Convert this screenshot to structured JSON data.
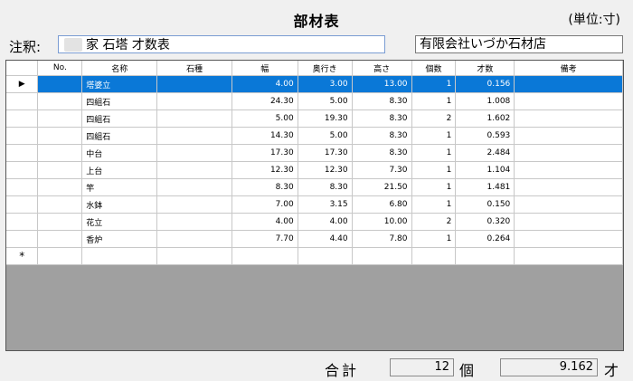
{
  "header": {
    "title": "部材表",
    "unit_label": "(単位:寸)"
  },
  "note": {
    "label": "注釈:",
    "value": "家 石塔 才数表",
    "company": "有限会社いづか石材店"
  },
  "grid": {
    "columns": [
      "No.",
      "名称",
      "石種",
      "幅",
      "奥行き",
      "高さ",
      "個数",
      "才数",
      "備考"
    ],
    "row_marker": "▶",
    "new_row_marker": "*",
    "rows": [
      {
        "no": "",
        "name": "塔婆立",
        "stone": "",
        "width": "4.00",
        "depth": "3.00",
        "height": "13.00",
        "count": "1",
        "sai": "0.156",
        "note": ""
      },
      {
        "no": "",
        "name": "四組石",
        "stone": "",
        "width": "24.30",
        "depth": "5.00",
        "height": "8.30",
        "count": "1",
        "sai": "1.008",
        "note": ""
      },
      {
        "no": "",
        "name": "四組石",
        "stone": "",
        "width": "5.00",
        "depth": "19.30",
        "height": "8.30",
        "count": "2",
        "sai": "1.602",
        "note": ""
      },
      {
        "no": "",
        "name": "四組石",
        "stone": "",
        "width": "14.30",
        "depth": "5.00",
        "height": "8.30",
        "count": "1",
        "sai": "0.593",
        "note": ""
      },
      {
        "no": "",
        "name": "中台",
        "stone": "",
        "width": "17.30",
        "depth": "17.30",
        "height": "8.30",
        "count": "1",
        "sai": "2.484",
        "note": ""
      },
      {
        "no": "",
        "name": "上台",
        "stone": "",
        "width": "12.30",
        "depth": "12.30",
        "height": "7.30",
        "count": "1",
        "sai": "1.104",
        "note": ""
      },
      {
        "no": "",
        "name": "竿",
        "stone": "",
        "width": "8.30",
        "depth": "8.30",
        "height": "21.50",
        "count": "1",
        "sai": "1.481",
        "note": ""
      },
      {
        "no": "",
        "name": "水鉢",
        "stone": "",
        "width": "7.00",
        "depth": "3.15",
        "height": "6.80",
        "count": "1",
        "sai": "0.150",
        "note": ""
      },
      {
        "no": "",
        "name": "花立",
        "stone": "",
        "width": "4.00",
        "depth": "4.00",
        "height": "10.00",
        "count": "2",
        "sai": "0.320",
        "note": ""
      },
      {
        "no": "",
        "name": "香炉",
        "stone": "",
        "width": "7.70",
        "depth": "4.40",
        "height": "7.80",
        "count": "1",
        "sai": "0.264",
        "note": ""
      }
    ]
  },
  "totals": {
    "label": "合計",
    "count": "12",
    "count_unit": "個",
    "sai": "9.162",
    "sai_unit": "才"
  },
  "colors": {
    "selection": "#0a78d7",
    "grid_empty": "#a0a0a0",
    "window_bg": "#f0f0f0"
  }
}
